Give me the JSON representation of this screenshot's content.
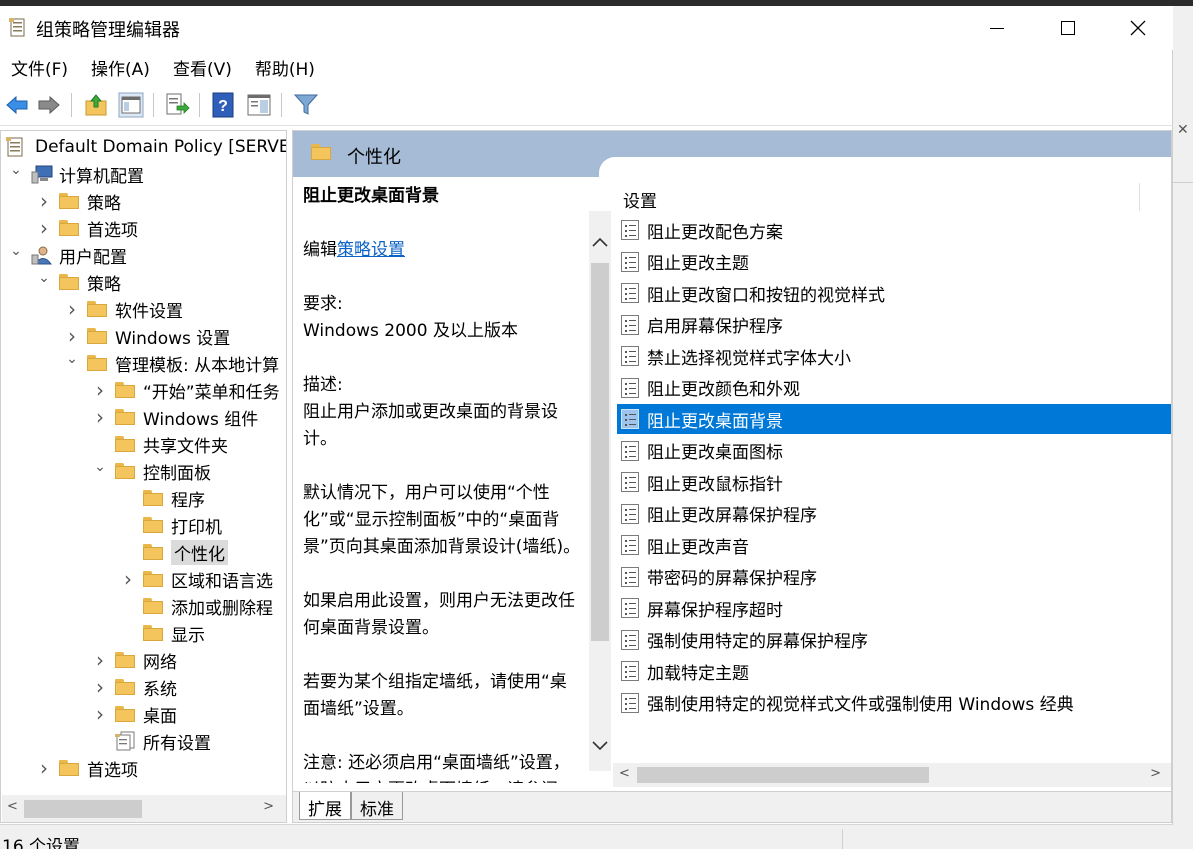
{
  "window": {
    "title": "组策略管理编辑器"
  },
  "menu": [
    "文件(F)",
    "操作(A)",
    "查看(V)",
    "帮助(H)"
  ],
  "toolbar": {
    "buttons": [
      "back-icon",
      "forward-icon",
      "up-folder-icon",
      "show-hide-tree-icon",
      "export-list-icon",
      "help-icon",
      "properties-pane-icon",
      "filter-icon"
    ]
  },
  "tree": {
    "root": "Default Domain Policy [SERVER",
    "items": [
      {
        "label": "计算机配置",
        "depth": 0,
        "arrow": "v",
        "icon": "computer-icon"
      },
      {
        "label": "策略",
        "depth": 1,
        "arrow": ">",
        "icon": "folder-icon"
      },
      {
        "label": "首选项",
        "depth": 1,
        "arrow": ">",
        "icon": "folder-icon"
      },
      {
        "label": "用户配置",
        "depth": 0,
        "arrow": "v",
        "icon": "user-icon"
      },
      {
        "label": "策略",
        "depth": 1,
        "arrow": "v",
        "icon": "folder-icon"
      },
      {
        "label": "软件设置",
        "depth": 2,
        "arrow": ">",
        "icon": "folder-icon"
      },
      {
        "label": "Windows 设置",
        "depth": 2,
        "arrow": ">",
        "icon": "folder-icon"
      },
      {
        "label": "管理模板: 从本地计算",
        "depth": 2,
        "arrow": "v",
        "icon": "folder-icon"
      },
      {
        "label": "“开始”菜单和任务",
        "depth": 3,
        "arrow": ">",
        "icon": "folder-icon"
      },
      {
        "label": "Windows 组件",
        "depth": 3,
        "arrow": ">",
        "icon": "folder-icon"
      },
      {
        "label": "共享文件夹",
        "depth": 3,
        "arrow": "",
        "icon": "folder-icon"
      },
      {
        "label": "控制面板",
        "depth": 3,
        "arrow": "v",
        "icon": "folder-icon"
      },
      {
        "label": "程序",
        "depth": 4,
        "arrow": "",
        "icon": "folder-icon"
      },
      {
        "label": "打印机",
        "depth": 4,
        "arrow": "",
        "icon": "folder-icon"
      },
      {
        "label": "个性化",
        "depth": 4,
        "arrow": "",
        "icon": "folder-icon",
        "selected": true
      },
      {
        "label": "区域和语言选",
        "depth": 4,
        "arrow": ">",
        "icon": "folder-icon"
      },
      {
        "label": "添加或删除程",
        "depth": 4,
        "arrow": "",
        "icon": "folder-icon"
      },
      {
        "label": "显示",
        "depth": 4,
        "arrow": "",
        "icon": "folder-icon"
      },
      {
        "label": "网络",
        "depth": 3,
        "arrow": ">",
        "icon": "folder-icon"
      },
      {
        "label": "系统",
        "depth": 3,
        "arrow": ">",
        "icon": "folder-icon"
      },
      {
        "label": "桌面",
        "depth": 3,
        "arrow": ">",
        "icon": "folder-icon"
      },
      {
        "label": "所有设置",
        "depth": 3,
        "arrow": "",
        "icon": "all-settings-icon"
      },
      {
        "label": "首选项",
        "depth": 1,
        "arrow": ">",
        "icon": "folder-icon"
      }
    ]
  },
  "right": {
    "header": "个性化",
    "desc": {
      "title": "阻止更改桌面背景",
      "edit_prefix": "编辑",
      "edit_link": "策略设置",
      "req_label": "要求:",
      "req_value": "Windows 2000 及以上版本",
      "desc_label": "描述:",
      "desc_text": "阻止用户添加或更改桌面的背景设计。",
      "p2": "默认情况下，用户可以使用“个性化”或“显示控制面板”中的“桌面背景”页向其桌面添加背景设计(墙纸)。",
      "p3": "如果启用此设置，则用户无法更改任何桌面背景设置。",
      "p4": "若要为某个组指定墙纸，请使用“桌面墙纸”设置。",
      "p5": "注意: 还必须启用“桌面墙纸”设置，以防止用户更改桌面墙纸。请参阅"
    },
    "column_header": "设置",
    "settings": [
      "阻止更改配色方案",
      "阻止更改主题",
      "阻止更改窗口和按钮的视觉样式",
      "启用屏幕保护程序",
      "禁止选择视觉样式字体大小",
      "阻止更改颜色和外观",
      "阻止更改桌面背景",
      "阻止更改桌面图标",
      "阻止更改鼠标指针",
      "阻止更改屏幕保护程序",
      "阻止更改声音",
      "带密码的屏幕保护程序",
      "屏幕保护程序超时",
      "强制使用特定的屏幕保护程序",
      "加载特定主题",
      "强制使用特定的视觉样式文件或强制使用 Windows 经典"
    ],
    "selected_index": 6,
    "tabs": [
      "扩展",
      "标准"
    ]
  },
  "status": {
    "text": "16 个设置"
  }
}
